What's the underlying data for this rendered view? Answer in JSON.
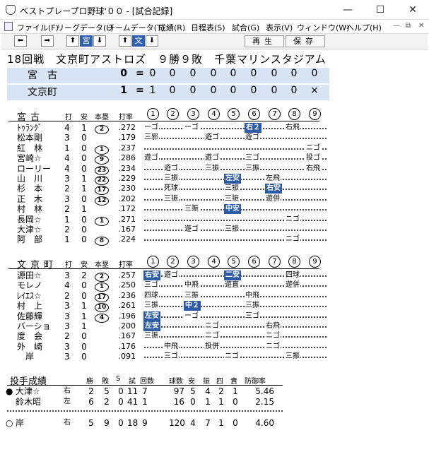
{
  "window": {
    "title": "ベストプレープロ野球'００ - [試合記録]"
  },
  "menu": [
    "ファイル(F)",
    "リーグデータ(L)",
    "チームデータ(T)",
    "成績(R)",
    "日程表(S)",
    "試合(G)",
    "表示(V)",
    "ウィンドウ(W)",
    "ヘルプ(H)"
  ],
  "toolbar": {
    "team1": "宮",
    "team2": "文",
    "replay": "再生",
    "save": "保存"
  },
  "game": {
    "heading": "18回戦　文京町アストロズ　９勝９敗　千葉マリンスタジアム"
  },
  "linescore": [
    {
      "team": "宮　古",
      "total": "0",
      "eq": "=",
      "innings": [
        "0",
        "0",
        "0",
        "0",
        "0",
        "0",
        "0",
        "0",
        "0"
      ]
    },
    {
      "team": "文京町",
      "total": "1",
      "eq": "=",
      "innings": [
        "1",
        "0",
        "0",
        "0",
        "0",
        "0",
        "0",
        "0",
        "×"
      ]
    }
  ],
  "batting_headers": {
    "ab": "打",
    "h": "安",
    "hr": "本塁",
    "avg": "打率",
    "innings": [
      "1",
      "2",
      "3",
      "4",
      "5",
      "6",
      "7",
      "8",
      "9"
    ]
  },
  "visitor": {
    "team": "宮古",
    "players": [
      {
        "name": "ﾄｩﾗﾝｸﾞ",
        "ab": "4",
        "h": "1",
        "hr": "2",
        "avg": ".272",
        "ev": [
          [
            "ーゴ",
            0,
            0
          ],
          [
            "ーゴ",
            2,
            0
          ],
          [
            "右２",
            5,
            1
          ],
          [
            "右飛",
            7,
            0
          ]
        ]
      },
      {
        "name": "松本剛",
        "ab": "3",
        "h": "0",
        "hr": "",
        "avg": ".179",
        "ev": [
          [
            "三邪",
            0,
            0
          ],
          [
            "遊ゴ",
            3,
            0
          ],
          [
            "遊ゴ",
            5,
            0
          ]
        ]
      },
      {
        "name": "紅　林",
        "ab": "1",
        "h": "0",
        "hr": "1",
        "avg": ".237",
        "ev": [
          [
            "ニゴ",
            8,
            0
          ]
        ]
      },
      {
        "name": "宮崎☆",
        "ab": "4",
        "h": "0",
        "hr": "9",
        "avg": ".286",
        "ev": [
          [
            "遊ゴ",
            0,
            0
          ],
          [
            "遊ゴ",
            3,
            0
          ],
          [
            "三ゴ",
            5,
            0
          ],
          [
            "投ゴ",
            8,
            0
          ]
        ]
      },
      {
        "name": "ローリー",
        "ab": "4",
        "h": "0",
        "hr": "23",
        "avg": ".234",
        "ev": [
          [
            "遊ゴ",
            1,
            0
          ],
          [
            "三振",
            3,
            0
          ],
          [
            "三振",
            5,
            0
          ],
          [
            "右飛",
            8,
            0
          ]
        ]
      },
      {
        "name": "山　川",
        "ab": "3",
        "h": "1",
        "hr": "22",
        "avg": ".229",
        "ev": [
          [
            "三振",
            1,
            0
          ],
          [
            "左安",
            4,
            1
          ],
          [
            "左飛",
            6,
            0
          ]
        ]
      },
      {
        "name": "杉　本",
        "ab": "2",
        "h": "1",
        "hr": "17",
        "avg": ".230",
        "ev": [
          [
            "死球",
            1,
            0
          ],
          [
            "三振",
            4,
            0
          ],
          [
            "右安",
            6,
            1
          ]
        ]
      },
      {
        "name": "正　木",
        "ab": "3",
        "h": "0",
        "hr": "12",
        "avg": ".202",
        "ev": [
          [
            "三振",
            1,
            0
          ],
          [
            "三振",
            4,
            0
          ],
          [
            "遊併",
            6,
            0
          ]
        ]
      },
      {
        "name": "村　林",
        "ab": "2",
        "h": "1",
        "hr": "",
        "avg": ".172",
        "ev": [
          [
            "三振",
            2,
            0
          ],
          [
            "中安",
            4,
            1
          ]
        ]
      },
      {
        "name": "長岡☆",
        "ab": "1",
        "h": "0",
        "hr": "1",
        "avg": ".271",
        "ev": [
          [
            "ニゴ",
            7,
            0
          ]
        ]
      },
      {
        "name": "大津☆",
        "ab": "2",
        "h": "0",
        "hr": "",
        "avg": ".167",
        "ev": [
          [
            "遊ゴ",
            2,
            0
          ],
          [
            "三振",
            4,
            0
          ]
        ]
      },
      {
        "name": "阿　部",
        "ab": "1",
        "h": "0",
        "hr": "8",
        "avg": ".224",
        "ev": [
          [
            "ニゴ",
            7,
            0
          ]
        ]
      }
    ]
  },
  "home": {
    "team": "文京町",
    "players": [
      {
        "name": "源田☆",
        "ab": "3",
        "h": "2",
        "hr": "2",
        "avg": ".257",
        "ev": [
          [
            "右安",
            0,
            1
          ],
          [
            "遊ゴ",
            1,
            0
          ],
          [
            "二安",
            4,
            1
          ],
          [
            "四球",
            7,
            0
          ]
        ]
      },
      {
        "name": "モレノ",
        "ab": "4",
        "h": "0",
        "hr": "1",
        "avg": ".250",
        "ev": [
          [
            "三ゴ",
            0,
            0
          ],
          [
            "中飛",
            2,
            0
          ],
          [
            "遊直",
            4,
            0
          ],
          [
            "遊併",
            7,
            0
          ]
        ]
      },
      {
        "name": "ﾚｲｴｽ☆",
        "ab": "2",
        "h": "0",
        "hr": "17",
        "avg": ".236",
        "ev": [
          [
            "四球",
            0,
            0
          ],
          [
            "三振",
            2,
            0
          ],
          [
            "中飛",
            5,
            0
          ]
        ]
      },
      {
        "name": "村　上",
        "ab": "3",
        "h": "1",
        "hr": "10",
        "avg": ".261",
        "ev": [
          [
            "三振",
            0,
            0
          ],
          [
            "中２",
            2,
            1
          ],
          [
            "三振",
            5,
            0
          ]
        ]
      },
      {
        "name": "佐藤輝",
        "ab": "3",
        "h": "1",
        "hr": "4",
        "avg": ".196",
        "ev": [
          [
            "左安",
            0,
            1
          ],
          [
            "ーゴ",
            2,
            0
          ],
          [
            "三ゴ",
            5,
            0
          ]
        ]
      },
      {
        "name": "バーショ",
        "ab": "3",
        "h": "1",
        "hr": "",
        "avg": ".200",
        "ev": [
          [
            "左安",
            0,
            1
          ],
          [
            "ニゴ",
            3,
            0
          ],
          [
            "右飛",
            6,
            0
          ]
        ]
      },
      {
        "name": "度　会",
        "ab": "2",
        "h": "0",
        "hr": "",
        "avg": ".167",
        "ev": [
          [
            "三振",
            0,
            0
          ],
          [
            "ニゴ",
            3,
            0
          ],
          [
            "ニゴ",
            6,
            0
          ]
        ]
      },
      {
        "name": "外　崎",
        "ab": "3",
        "h": "0",
        "hr": "",
        "avg": ".176",
        "ev": [
          [
            "中飛",
            1,
            0
          ],
          [
            "投併",
            3,
            0
          ],
          [
            "ニゴ",
            6,
            0
          ]
        ]
      },
      {
        "name": "　岸",
        "ab": "3",
        "h": "0",
        "hr": "",
        "avg": ".091",
        "ev": [
          [
            "三ゴ",
            1,
            0
          ],
          [
            "ニゴ",
            4,
            0
          ],
          [
            "三振",
            7,
            0
          ]
        ]
      }
    ]
  },
  "pitching": {
    "title": "投手成績",
    "headers": [
      "勝",
      "敗",
      "S",
      "試",
      "回数",
      "球数",
      "安",
      "振",
      "四",
      "責",
      "防御率"
    ],
    "rows": [
      {
        "mark": "●",
        "name": "大津☆",
        "hand": "右",
        "w": "2",
        "l": "5",
        "s": "0",
        "g": "11",
        "ip": "7",
        "np": "97",
        "h": "5",
        "k": "4",
        "bb": "2",
        "er": "1",
        "era": "5.46"
      },
      {
        "mark": "",
        "name": "鈴木昭",
        "hand": "左",
        "w": "6",
        "l": "2",
        "s": "0",
        "g": "41",
        "ip": "1",
        "np": "16",
        "h": "0",
        "k": "1",
        "bb": "1",
        "er": "0",
        "era": "2.15"
      },
      {
        "mark": "○",
        "name": "岸",
        "hand": "右",
        "w": "5",
        "l": "9",
        "s": "0",
        "g": "18",
        "ip": "9",
        "np": "120",
        "h": "4",
        "k": "7",
        "bb": "1",
        "er": "0",
        "era": "4.60"
      }
    ]
  },
  "colors": {
    "score_bg": "#d7e4f3",
    "highlight": "#2d5aa4"
  }
}
